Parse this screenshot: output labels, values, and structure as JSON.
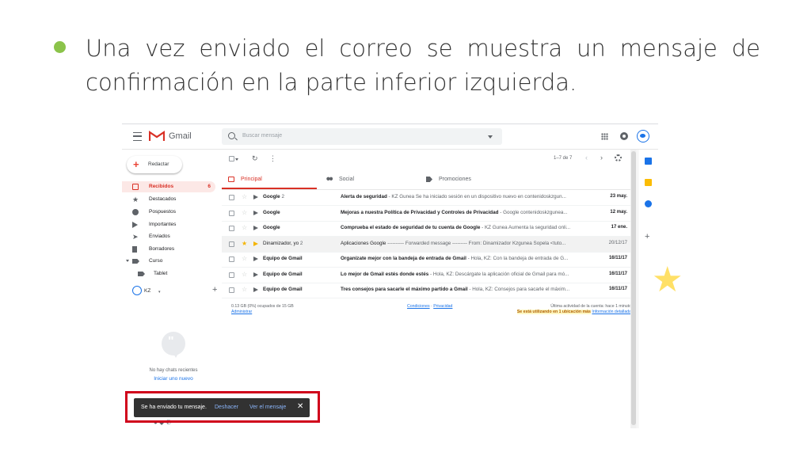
{
  "slide": {
    "text_line1": "Una vez enviado el correo se muestra un mensaje de",
    "text_line2": "confirmación en la parte inferior izquierda.",
    "bullet_color": "#8bc34a"
  },
  "gmail": {
    "logo_text": "Gmail",
    "search_placeholder": "Buscar mensaje",
    "compose_label": "Redactar",
    "nav": [
      {
        "label": "Recibidos",
        "count": "6",
        "icon": "inbox-icon"
      },
      {
        "label": "Destacados",
        "icon": "star-icon"
      },
      {
        "label": "Pospuestos",
        "icon": "clock-icon"
      },
      {
        "label": "Importantes",
        "icon": "important-icon"
      },
      {
        "label": "Enviados",
        "icon": "send-icon"
      },
      {
        "label": "Borradores",
        "icon": "draft-icon"
      },
      {
        "label": "Curso",
        "icon": "label-icon"
      },
      {
        "label": "Tablet",
        "icon": "label-icon"
      }
    ],
    "hangouts": {
      "user": "KZ",
      "no_chats": "No hay chats recientes",
      "start_new": "Iniciar uno nuevo"
    },
    "pager": "1–7 de 7",
    "tabs": [
      {
        "label": "Principal",
        "icon": "inbox-icon"
      },
      {
        "label": "Social",
        "icon": "people-icon"
      },
      {
        "label": "Promociones",
        "icon": "tag-icon"
      }
    ],
    "emails": [
      {
        "sender": "Google",
        "count": "2",
        "subject": "Alerta de seguridad",
        "snippet": " - KZ Gunea Se ha iniciado sesión en un dispositivo nuevo en contenidoskzgun...",
        "date": "23 may."
      },
      {
        "sender": "Google",
        "count": "",
        "subject": "Mejoras a nuestra Política de Privacidad y Controles de Privacidad",
        "snippet": " - Google contenidoskzgunea...",
        "date": "12 may."
      },
      {
        "sender": "Google",
        "count": "",
        "subject": "Comprueba el estado de seguridad de tu cuenta de Google",
        "snippet": " - KZ Gunea Aumenta la seguridad onli...",
        "date": "17 ene."
      },
      {
        "sender": "Dinamizador, yo",
        "count": "2",
        "subject": "Aplicaciones Google",
        "snippet": " ---------- Forwarded message --------- From: Dinamizador Kzgunea Sopela <tuto...",
        "date": "20/12/17"
      },
      {
        "sender": "Equipo de Gmail",
        "count": "",
        "subject": "Organízate mejor con la bandeja de entrada de Gmail",
        "snippet": " - Hola, KZ: Con la bandeja de entrada de G...",
        "date": "16/11/17"
      },
      {
        "sender": "Equipo de Gmail",
        "count": "",
        "subject": "Lo mejor de Gmail estés donde estés",
        "snippet": " - Hola, KZ: Descárgate la aplicación oficial de Gmail para mó...",
        "date": "16/11/17"
      },
      {
        "sender": "Equipo de Gmail",
        "count": "",
        "subject": "Tres consejos para sacarle el máximo partido a Gmail",
        "snippet": " - Hola, KZ: Consejos para sacarle el máxim...",
        "date": "16/11/17"
      }
    ],
    "footer": {
      "storage": "0.13 GB (0%) ocupados de 15 GB",
      "manage": "Administrar",
      "terms": "Condiciones",
      "sep": " · ",
      "privacy": "Privacidad",
      "last_activity": "Última actividad de la cuenta: hace 1 minuto",
      "locations_warn": "Se está utilizando en 1 ubicación más",
      "details": "Información detallada"
    },
    "snackbar": {
      "message": "Se ha enviado tu mensaje.",
      "undo": "Deshacer",
      "view": "Ver el mensaje"
    }
  },
  "colors": {
    "accent_red": "#d93025",
    "snackbar_bg": "#323232",
    "highlight_box": "#d0021b",
    "link_blue": "#8ab4f8"
  }
}
